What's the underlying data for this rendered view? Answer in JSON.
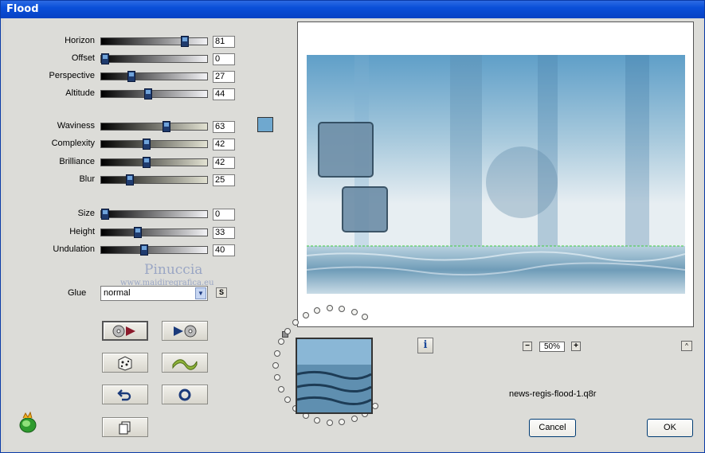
{
  "window": {
    "title": "Flood"
  },
  "sliders": [
    {
      "label": "Horizon",
      "value": "81",
      "level": 81,
      "gradient": "linear-gradient(90deg,#000,#f3f3f6)"
    },
    {
      "label": "Offset",
      "value": "0",
      "level": 0,
      "gradient": "linear-gradient(90deg,#000,#f3f3f6)"
    },
    {
      "label": "Perspective",
      "value": "27",
      "level": 27,
      "gradient": "linear-gradient(90deg,#000,#f3f3f6)"
    },
    {
      "label": "Altitude",
      "value": "44",
      "level": 44,
      "gradient": "linear-gradient(90deg,#000,#f3f3f6)"
    },
    {
      "label": "Waviness",
      "value": "63",
      "level": 63,
      "gradient": "linear-gradient(90deg,#000,#e2e2d2)"
    },
    {
      "label": "Complexity",
      "value": "42",
      "level": 42,
      "gradient": "linear-gradient(90deg,#000,#e2e2d2)"
    },
    {
      "label": "Brilliance",
      "value": "42",
      "level": 42,
      "gradient": "linear-gradient(90deg,#000,#e2e2d2)"
    },
    {
      "label": "Blur",
      "value": "25",
      "level": 25,
      "gradient": "linear-gradient(90deg,#000,#e2e2d2)"
    },
    {
      "label": "Size",
      "value": "0",
      "level": 0,
      "gradient": "linear-gradient(90deg,#000,#f3f3f6)"
    },
    {
      "label": "Height",
      "value": "33",
      "level": 33,
      "gradient": "linear-gradient(90deg,#000,#f3f3f6)"
    },
    {
      "label": "Undulation",
      "value": "40",
      "level": 40,
      "gradient": "linear-gradient(90deg,#000,#f3f3f6)"
    }
  ],
  "color_swatch": "#6fa8cf",
  "watermark": {
    "name": "Pinuccia",
    "url": "www.maidiregrafica.eu"
  },
  "glue": {
    "label": "Glue",
    "value": "normal",
    "s_label": "S"
  },
  "buttons": [
    {
      "name": "preset-load-button",
      "icon": "disc-arrow-icon"
    },
    {
      "name": "preset-save-button",
      "icon": "arrow-disc-icon"
    },
    {
      "name": "random-button",
      "icon": "dice-icon"
    },
    {
      "name": "wave-button",
      "icon": "wave-icon"
    },
    {
      "name": "undo-button",
      "icon": "undo-arrow-icon"
    },
    {
      "name": "reset-button",
      "icon": "ring-icon"
    },
    {
      "name": "copy-button",
      "icon": "copy-page-icon"
    }
  ],
  "preview": {
    "zoom": "50%",
    "info_label": "i",
    "zoom_out_label": "−",
    "zoom_in_label": "+",
    "up_label": "^"
  },
  "filename": "news-regis-flood-1.q8r",
  "dialog": {
    "cancel_label": "Cancel",
    "ok_label": "OK"
  }
}
